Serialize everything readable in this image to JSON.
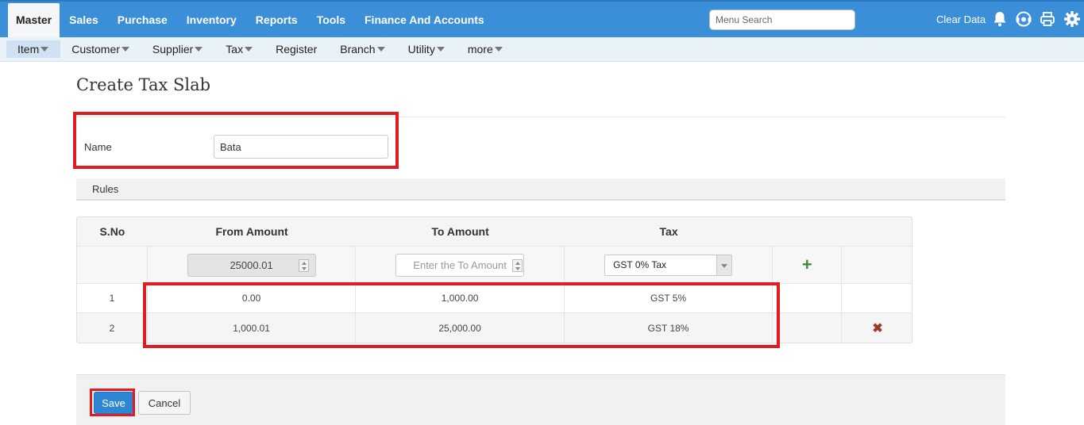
{
  "top_nav": {
    "items": [
      "Master",
      "Sales",
      "Purchase",
      "Inventory",
      "Reports",
      "Tools",
      "Finance And Accounts"
    ],
    "active": "Master",
    "search_placeholder": "Menu Search",
    "clear_data": "Clear Data",
    "icons": [
      "bell-icon",
      "support-icon",
      "print-icon",
      "gear-icon"
    ]
  },
  "sub_nav": {
    "items": [
      {
        "label": "Item",
        "dropdown": true
      },
      {
        "label": "Customer",
        "dropdown": true
      },
      {
        "label": "Supplier",
        "dropdown": true
      },
      {
        "label": "Tax",
        "dropdown": true
      },
      {
        "label": "Register",
        "dropdown": false
      },
      {
        "label": "Branch",
        "dropdown": true
      },
      {
        "label": "Utility",
        "dropdown": true
      },
      {
        "label": "more",
        "dropdown": true
      }
    ],
    "active": "Item"
  },
  "page": {
    "title": "Create Tax Slab",
    "name_label": "Name",
    "name_value": "Bata",
    "rules_label": "Rules"
  },
  "table": {
    "headers": [
      "S.No",
      "From Amount",
      "To Amount",
      "Tax"
    ],
    "entry": {
      "from_amount": "25000.01",
      "to_amount_placeholder": "Enter the To Amount",
      "tax_selected": "GST 0% Tax"
    },
    "rows": [
      {
        "sno": "1",
        "from": "0.00",
        "to": "1,000.00",
        "tax": "GST 5%"
      },
      {
        "sno": "2",
        "from": "1,000.01",
        "to": "25,000.00",
        "tax": "GST 18%"
      }
    ]
  },
  "footer": {
    "save": "Save",
    "cancel": "Cancel"
  },
  "colors": {
    "header_blue": "#3a8fd8",
    "highlight_red": "#e11b22",
    "save_blue": "#2f86d4"
  }
}
